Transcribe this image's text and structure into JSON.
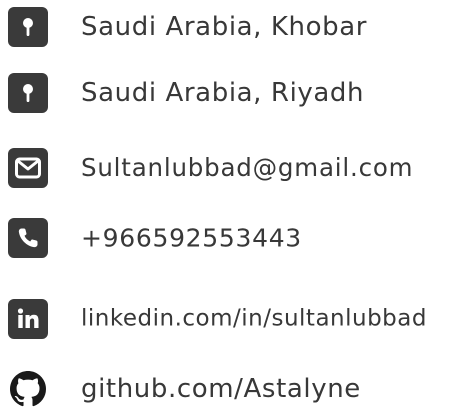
{
  "contacts": [
    {
      "icon": "map-pin-icon",
      "text": "Saudi Arabia, Khobar"
    },
    {
      "icon": "map-pin-icon",
      "text": "Saudi Arabia, Riyadh"
    },
    {
      "icon": "envelope-icon",
      "text": "Sultanlubbad@gmail.com"
    },
    {
      "icon": "phone-icon",
      "text": "+966592553443"
    },
    {
      "icon": "linkedin-icon",
      "text": "linkedin.com/in/sultanlubbad"
    },
    {
      "icon": "github-icon",
      "text": "github.com/Astalyne"
    }
  ],
  "colors": {
    "icon": "#3a3a3a",
    "text": "#383838",
    "background": "#ffffff"
  }
}
